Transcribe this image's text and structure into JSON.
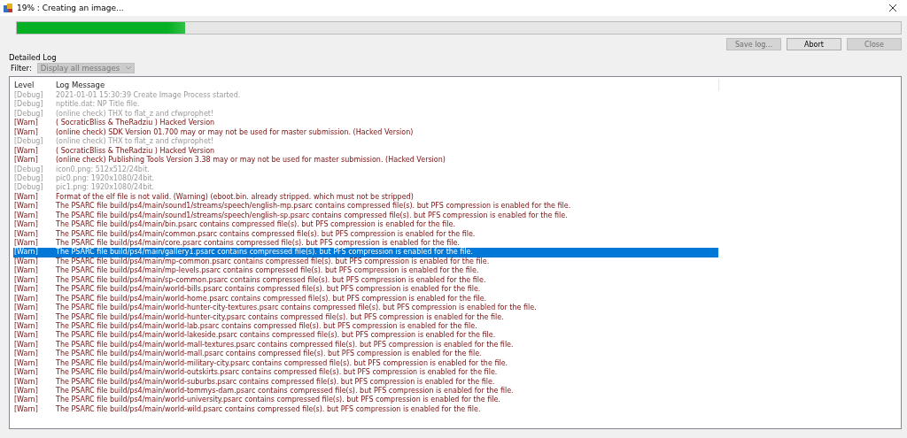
{
  "window": {
    "title": "19% : Creating an image..."
  },
  "progress": {
    "level": 0.19
  },
  "buttons": [
    {
      "label": "Save log...",
      "disabled": true
    },
    {
      "label": "Abort",
      "disabled": false
    },
    {
      "label": "Close",
      "disabled": true
    }
  ],
  "group_title": "Detailed Log",
  "filter": {
    "label": "Filter:",
    "value": "Display all messages",
    "disabled": true
  },
  "log": {
    "columns": [
      "Level",
      "Log Message"
    ],
    "rows": [
      {
        "kind": "debug",
        "level": "[Debug]",
        "message": "2021-01-01 15:30:39 Create Image Process started.",
        "selected": false
      },
      {
        "kind": "debug",
        "level": "[Debug]",
        "message": "nptitle.dat: NP Title file.",
        "selected": false
      },
      {
        "kind": "debug",
        "level": "[Debug]",
        "message": "(online check) THX to flat_z and cfwprophet!",
        "selected": false
      },
      {
        "kind": "warn",
        "level": "[Warn]",
        "message": "( SocraticBliss & TheRadziu ) Hacked Version",
        "selected": false
      },
      {
        "kind": "warn",
        "level": "[Warn]",
        "message": "(online check) SDK Version 01.700 may or may not be used for master submission. (Hacked Version)",
        "selected": false
      },
      {
        "kind": "debug",
        "level": "[Debug]",
        "message": "(online check) THX to flat_z and cfwprophet!",
        "selected": false
      },
      {
        "kind": "warn",
        "level": "[Warn]",
        "message": "( SocraticBliss & TheRadziu ) Hacked Version",
        "selected": false
      },
      {
        "kind": "warn",
        "level": "[Warn]",
        "message": "(online check) Publishing Tools Version 3.38 may or may not be used for master submission. (Hacked Version)",
        "selected": false
      },
      {
        "kind": "debug",
        "level": "[Debug]",
        "message": "icon0.png: 512x512/24bit.",
        "selected": false
      },
      {
        "kind": "debug",
        "level": "[Debug]",
        "message": "pic0.png: 1920x1080/24bit.",
        "selected": false
      },
      {
        "kind": "debug",
        "level": "[Debug]",
        "message": "pic1.png: 1920x1080/24bit.",
        "selected": false
      },
      {
        "kind": "warn",
        "level": "[Warn]",
        "message": "Format of the elf file is not valid. (Warning) (eboot.bin. already stripped. which must not be stripped)",
        "selected": false
      },
      {
        "kind": "warn",
        "level": "[Warn]",
        "message": "The PSARC file build/ps4/main/sound1/streams/speech/english-mp.psarc contains compressed file(s). but PFS compression is enabled for the file.",
        "selected": false
      },
      {
        "kind": "warn",
        "level": "[Warn]",
        "message": "The PSARC file build/ps4/main/sound1/streams/speech/english-sp.psarc contains compressed file(s). but PFS compression is enabled for the file.",
        "selected": false
      },
      {
        "kind": "warn",
        "level": "[Warn]",
        "message": "The PSARC file build/ps4/main/bin.psarc contains compressed file(s). but PFS compression is enabled for the file.",
        "selected": false
      },
      {
        "kind": "warn",
        "level": "[Warn]",
        "message": "The PSARC file build/ps4/main/common.psarc contains compressed file(s). but PFS compression is enabled for the file.",
        "selected": false
      },
      {
        "kind": "warn",
        "level": "[Warn]",
        "message": "The PSARC file build/ps4/main/core.psarc contains compressed file(s). but PFS compression is enabled for the file.",
        "selected": false
      },
      {
        "kind": "warn",
        "level": "[Warn]",
        "message": "The PSARC file build/ps4/main/gallery1.psarc contains compressed file(s). but PFS compression is enabled for the file.",
        "selected": true
      },
      {
        "kind": "warn",
        "level": "[Warn]",
        "message": "The PSARC file build/ps4/main/mp-common.psarc contains compressed file(s). but PFS compression is enabled for the file.",
        "selected": false
      },
      {
        "kind": "warn",
        "level": "[Warn]",
        "message": "The PSARC file build/ps4/main/mp-levels.psarc contains compressed file(s). but PFS compression is enabled for the file.",
        "selected": false
      },
      {
        "kind": "warn",
        "level": "[Warn]",
        "message": "The PSARC file build/ps4/main/sp-common.psarc contains compressed file(s). but PFS compression is enabled for the file.",
        "selected": false
      },
      {
        "kind": "warn",
        "level": "[Warn]",
        "message": "The PSARC file build/ps4/main/world-bills.psarc contains compressed file(s). but PFS compression is enabled for the file.",
        "selected": false
      },
      {
        "kind": "warn",
        "level": "[Warn]",
        "message": "The PSARC file build/ps4/main/world-home.psarc contains compressed file(s). but PFS compression is enabled for the file.",
        "selected": false
      },
      {
        "kind": "warn",
        "level": "[Warn]",
        "message": "The PSARC file build/ps4/main/world-hunter-city-textures.psarc contains compressed file(s). but PFS compression is enabled for the file.",
        "selected": false
      },
      {
        "kind": "warn",
        "level": "[Warn]",
        "message": "The PSARC file build/ps4/main/world-hunter-city.psarc contains compressed file(s). but PFS compression is enabled for the file.",
        "selected": false
      },
      {
        "kind": "warn",
        "level": "[Warn]",
        "message": "The PSARC file build/ps4/main/world-lab.psarc contains compressed file(s). but PFS compression is enabled for the file.",
        "selected": false
      },
      {
        "kind": "warn",
        "level": "[Warn]",
        "message": "The PSARC file build/ps4/main/world-lakeside.psarc contains compressed file(s). but PFS compression is enabled for the file.",
        "selected": false
      },
      {
        "kind": "warn",
        "level": "[Warn]",
        "message": "The PSARC file build/ps4/main/world-mall-textures.psarc contains compressed file(s). but PFS compression is enabled for the file.",
        "selected": false
      },
      {
        "kind": "warn",
        "level": "[Warn]",
        "message": "The PSARC file build/ps4/main/world-mall.psarc contains compressed file(s). but PFS compression is enabled for the file.",
        "selected": false
      },
      {
        "kind": "warn",
        "level": "[Warn]",
        "message": "The PSARC file build/ps4/main/world-military-city.psarc contains compressed file(s). but PFS compression is enabled for the file.",
        "selected": false
      },
      {
        "kind": "warn",
        "level": "[Warn]",
        "message": "The PSARC file build/ps4/main/world-outskirts.psarc contains compressed file(s). but PFS compression is enabled for the file.",
        "selected": false
      },
      {
        "kind": "warn",
        "level": "[Warn]",
        "message": "The PSARC file build/ps4/main/world-suburbs.psarc contains compressed file(s). but PFS compression is enabled for the file.",
        "selected": false
      },
      {
        "kind": "warn",
        "level": "[Warn]",
        "message": "The PSARC file build/ps4/main/world-tommys-dam.psarc contains compressed file(s). but PFS compression is enabled for the file.",
        "selected": false
      },
      {
        "kind": "warn",
        "level": "[Warn]",
        "message": "The PSARC file build/ps4/main/world-university.psarc contains compressed file(s). but PFS compression is enabled for the file.",
        "selected": false
      },
      {
        "kind": "warn",
        "level": "[Warn]",
        "message": "The PSARC file build/ps4/main/world-wild.psarc contains compressed file(s). but PFS compression is enabled for the file.",
        "selected": false
      }
    ]
  }
}
